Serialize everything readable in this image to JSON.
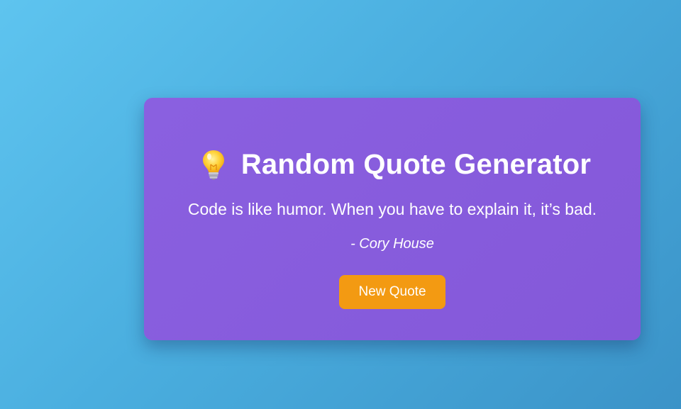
{
  "app": {
    "title": "Random Quote Generator",
    "title_icon": "lightbulb-icon"
  },
  "quote": {
    "text": "Code is like humor. When you have to explain it, it’s bad.",
    "author": "- Cory House"
  },
  "actions": {
    "new_quote_label": "New Quote"
  },
  "colors": {
    "background_start": "#5ec4ef",
    "background_end": "#3b93c8",
    "card": "#8a60e0",
    "button": "#f39a12",
    "text": "#ffffff"
  }
}
